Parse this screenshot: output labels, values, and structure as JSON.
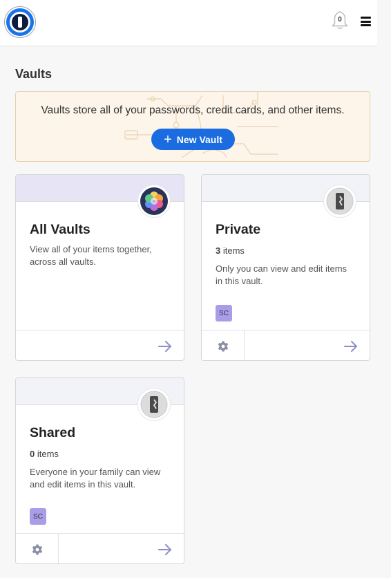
{
  "header": {
    "logo_icon": "1password-logo-icon",
    "notification_count": "0",
    "bell_icon": "bell-icon",
    "menu_icon": "hamburger-menu-icon"
  },
  "page": {
    "title": "Vaults"
  },
  "banner": {
    "text": "Vaults store all of your passwords, credit cards, and other items.",
    "new_vault_label": "New Vault",
    "new_vault_icon": "plus-icon"
  },
  "vaults": [
    {
      "name": "All Vaults",
      "description": "View all of your items together, across all vaults.",
      "band_color": "#e6e4f5",
      "icon": "multicolor-vault-icon"
    },
    {
      "name": "Private",
      "count": "3",
      "count_suffix": "items",
      "description": "Only you can view and edit items in this vault.",
      "badge": "SC",
      "band_color": "#f2f3f8",
      "icon": "vault-keyhole-icon"
    },
    {
      "name": "Shared",
      "count": "0",
      "count_suffix": "items",
      "description": "Everyone in your family can view and edit items in this vault.",
      "badge": "SC",
      "band_color": "#f2f3f8",
      "icon": "vault-keyhole-icon"
    }
  ],
  "colors": {
    "accent": "#1a6ce0",
    "badge": "#a99de8",
    "banner_bg": "#fdf5ea",
    "banner_border": "#e6cfa6"
  }
}
